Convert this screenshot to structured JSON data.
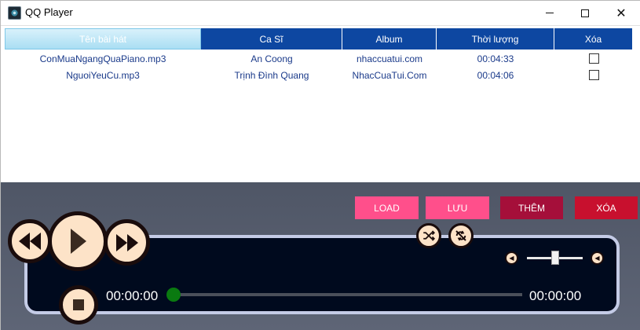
{
  "window": {
    "title": "QQ Player"
  },
  "table": {
    "columns": [
      {
        "label": "Tên bài hát"
      },
      {
        "label": "Ca Sĩ"
      },
      {
        "label": "Album"
      },
      {
        "label": "Thời lượng"
      },
      {
        "label": "Xóa"
      }
    ],
    "rows": [
      {
        "title": "ConMuaNgangQuaPiano.mp3",
        "artist": "An Coong",
        "album": "nhaccuatui.com",
        "duration": "00:04:33",
        "delete_checked": false
      },
      {
        "title": "NguoiYeuCu.mp3",
        "artist": "Trịnh Đình Quang",
        "album": "NhacCuaTui.Com",
        "duration": "00:04:06",
        "delete_checked": false
      }
    ]
  },
  "actions": {
    "load": "LOAD",
    "save": "LƯU",
    "add": "THÊM",
    "delete": "XÓA"
  },
  "player": {
    "current_time": "00:00:00",
    "total_time": "00:00:00",
    "seek_fraction": 0,
    "volume_fraction": 0.5
  },
  "colors": {
    "header_bg": "#0d47a1",
    "pink_button": "#ff4f8b",
    "add_button": "#a50f3a",
    "delete_button": "#c8102e",
    "panel_bg": "#565d6d",
    "screen_bg": "#000a1e",
    "control_fill": "#fde3c8",
    "seek_thumb": "#0a7a10"
  },
  "icons": {
    "rewind": "rewind-icon",
    "play": "play-icon",
    "forward": "fast-forward-icon",
    "stop": "stop-icon",
    "shuffle": "shuffle-icon",
    "repeat": "repeat-off-icon",
    "volume_low": "volume-low-icon",
    "volume_high": "volume-high-icon"
  }
}
